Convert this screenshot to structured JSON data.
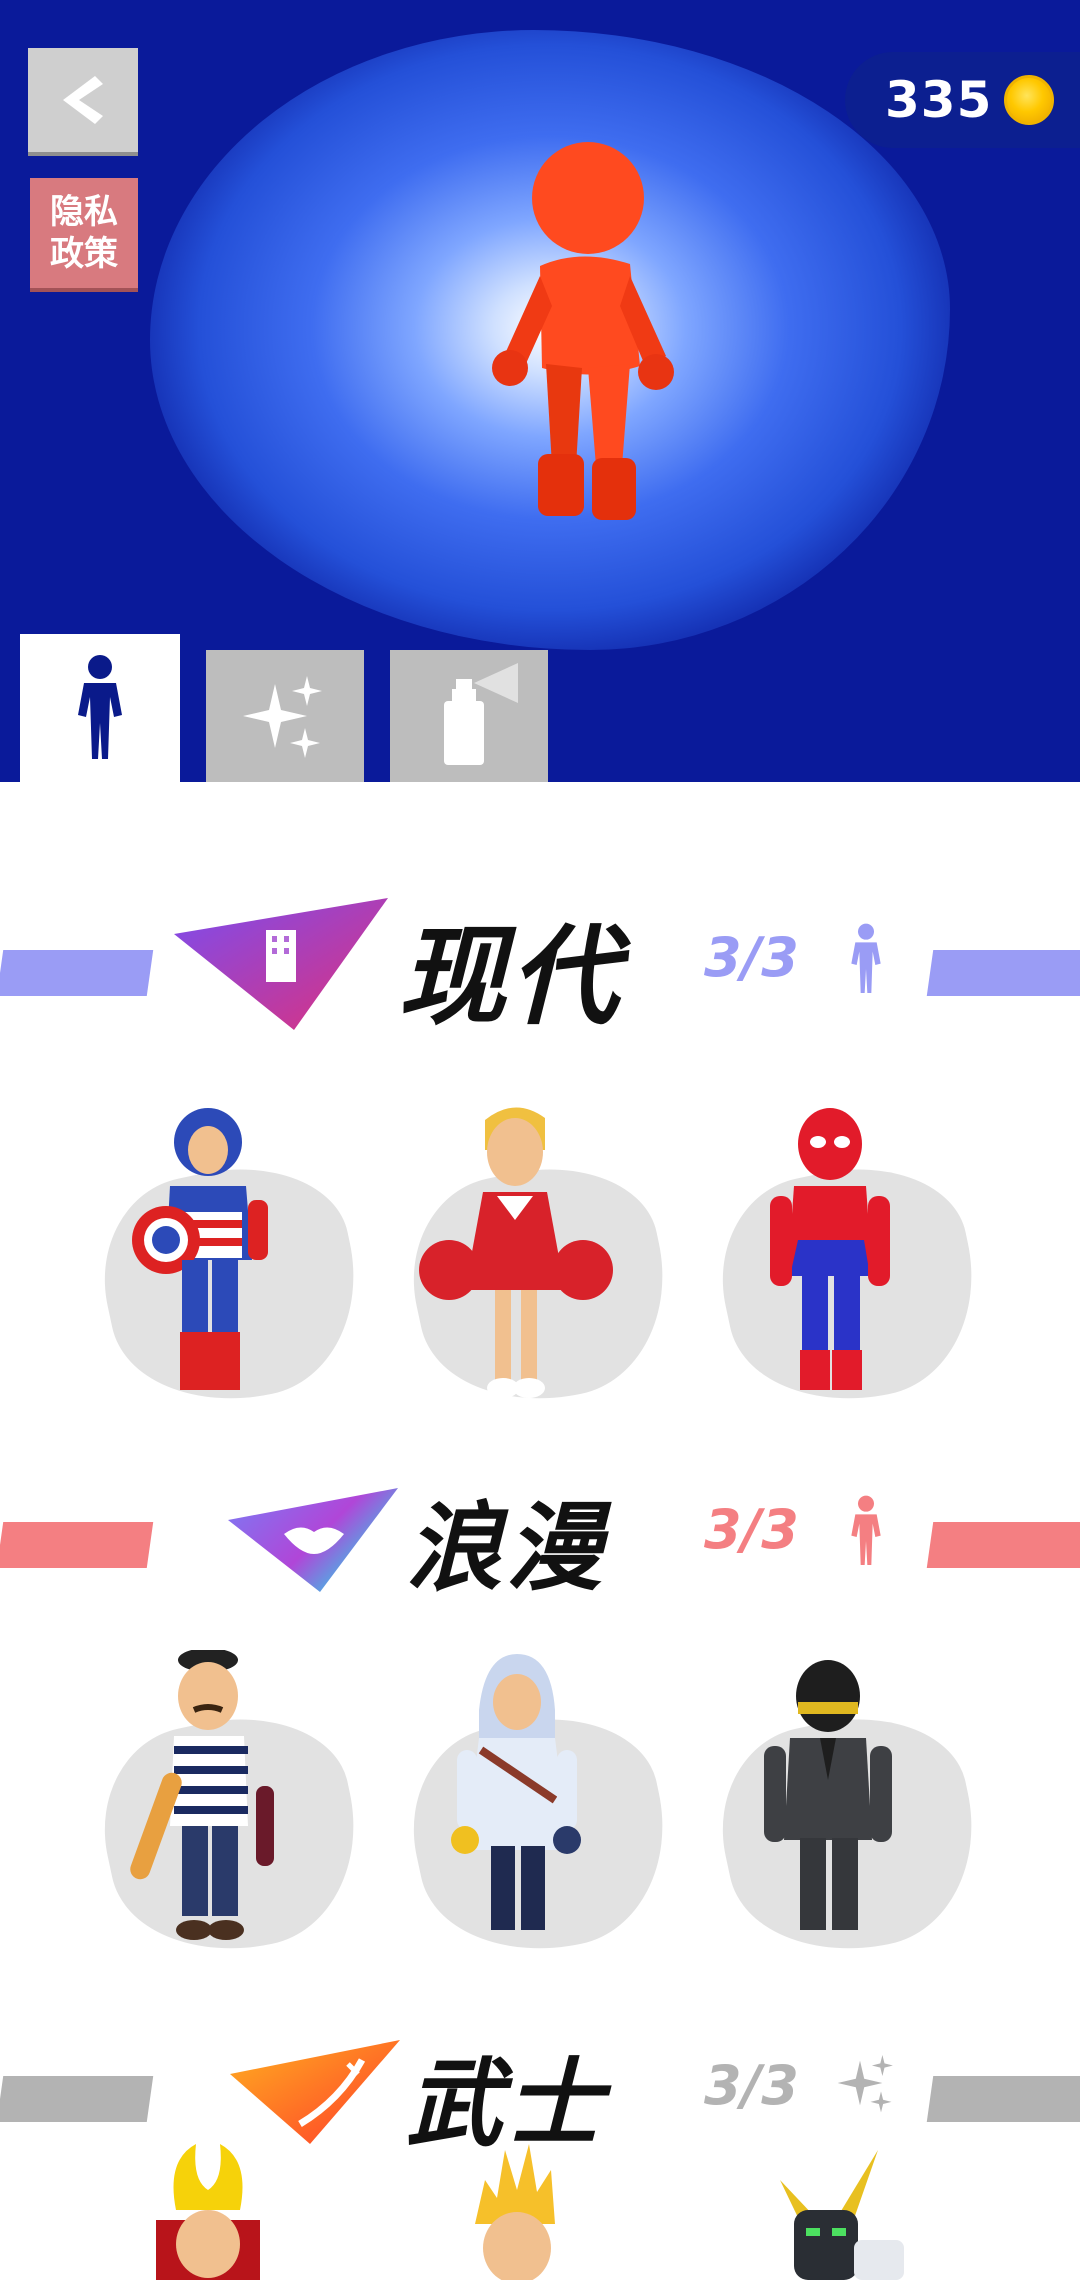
{
  "privacy_label": "隐私\n政策",
  "coins": "335",
  "tabs": [
    {
      "name": "tab-characters",
      "icon": "person-icon",
      "selected": true
    },
    {
      "name": "tab-effects",
      "icon": "sparkles-icon",
      "selected": false
    },
    {
      "name": "tab-spray",
      "icon": "spray-can-icon",
      "selected": false
    }
  ],
  "sections": [
    {
      "title": "现代",
      "count": "3/3",
      "color": "#9a9cf5",
      "icon": "building-icon",
      "reward_icon": "person-icon",
      "characters": [
        "captain-america-character",
        "cheerleader-character",
        "spider-man-character"
      ]
    },
    {
      "title": "浪漫",
      "count": "3/3",
      "color": "#f47f82",
      "icon": "lips-icon",
      "reward_icon": "person-icon",
      "characters": [
        "french-mime-character",
        "assassin-character",
        "daft-punk-character"
      ]
    },
    {
      "title": "武士",
      "count": "3/3",
      "color": "#b3b3b3",
      "icon": "katana-icon",
      "reward_icon": "sparkles-icon",
      "characters": [
        "samurai-character",
        "super-saiyan-character",
        "mecha-character"
      ]
    }
  ],
  "colors": {
    "top_bg": "#0a1a9a",
    "hero": "#ff4a1f"
  }
}
